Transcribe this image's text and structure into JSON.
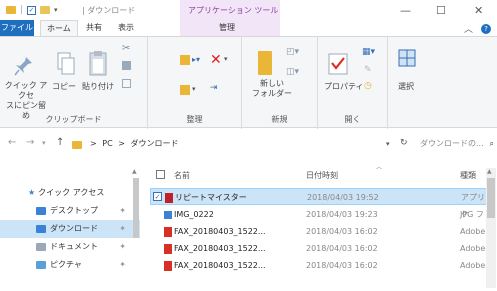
{
  "window": {
    "title": "| ダウンロード",
    "context_tab_title": "アプリケーション ツール",
    "controls": [
      "—",
      "☐",
      "✕"
    ]
  },
  "ribbon_tabs": [
    {
      "label": "ファイル"
    },
    {
      "label": "ホーム"
    },
    {
      "label": "共有"
    },
    {
      "label": "表示"
    },
    {
      "label": "管理"
    }
  ],
  "ribbon": {
    "clipboard": {
      "label": "クリップボード",
      "pin_label": "クイック アクセ\nスにピン留め",
      "copy_label": "コピー",
      "paste_label": "貼り付け"
    },
    "organize": {
      "label": "整理"
    },
    "new": {
      "label": "新規",
      "new_folder_label": "新しい\nフォルダー"
    },
    "open": {
      "label": "開く",
      "properties_label": "プロパティ"
    },
    "select": {
      "label": "選択"
    }
  },
  "addressbar": {
    "path": [
      ">",
      "PC",
      ">",
      "ダウンロード"
    ],
    "search_placeholder": "ダウンロードの..."
  },
  "navpane": {
    "items": [
      {
        "label": "クイック アクセス",
        "icon": "star-icon",
        "pinned": false,
        "selected": false
      },
      {
        "label": "デスクトップ",
        "icon": "desktop-folder-icon",
        "pinned": true,
        "selected": false
      },
      {
        "label": "ダウンロード",
        "icon": "download-folder-icon",
        "pinned": true,
        "selected": true
      },
      {
        "label": "ドキュメント",
        "icon": "documents-folder-icon",
        "pinned": true,
        "selected": false
      },
      {
        "label": "ピクチャ",
        "icon": "pictures-folder-icon",
        "pinned": true,
        "selected": false
      }
    ]
  },
  "filelist": {
    "columns": {
      "name": "名前",
      "date": "日付時刻",
      "type": "種類"
    },
    "rows": [
      {
        "name": "リピートマイスター",
        "date": "2018/04/03 19:52",
        "type": "アプリケ",
        "icon": "app-icon",
        "selected": true
      },
      {
        "name": "IMG_0222",
        "date": "2018/04/03 19:23",
        "type": "JPG フ",
        "icon": "image-icon",
        "selected": false
      },
      {
        "name": "FAX_20180403_1522...",
        "date": "2018/04/03 16:02",
        "type": "Adobe",
        "icon": "pdf-icon",
        "selected": false
      },
      {
        "name": "FAX_20180403_1522...",
        "date": "2018/04/03 16:02",
        "type": "Adobe",
        "icon": "pdf-icon",
        "selected": false
      },
      {
        "name": "FAX_20180403_1522...",
        "date": "2018/04/03 16:02",
        "type": "Adobe",
        "icon": "pdf-icon",
        "selected": false
      }
    ]
  },
  "colors": {
    "file_tab": "#1e6fbf",
    "context_tab": "#f2e5f7",
    "selection": "#cce4f7",
    "folder": "#e9b638",
    "pdf": "#d93025"
  }
}
